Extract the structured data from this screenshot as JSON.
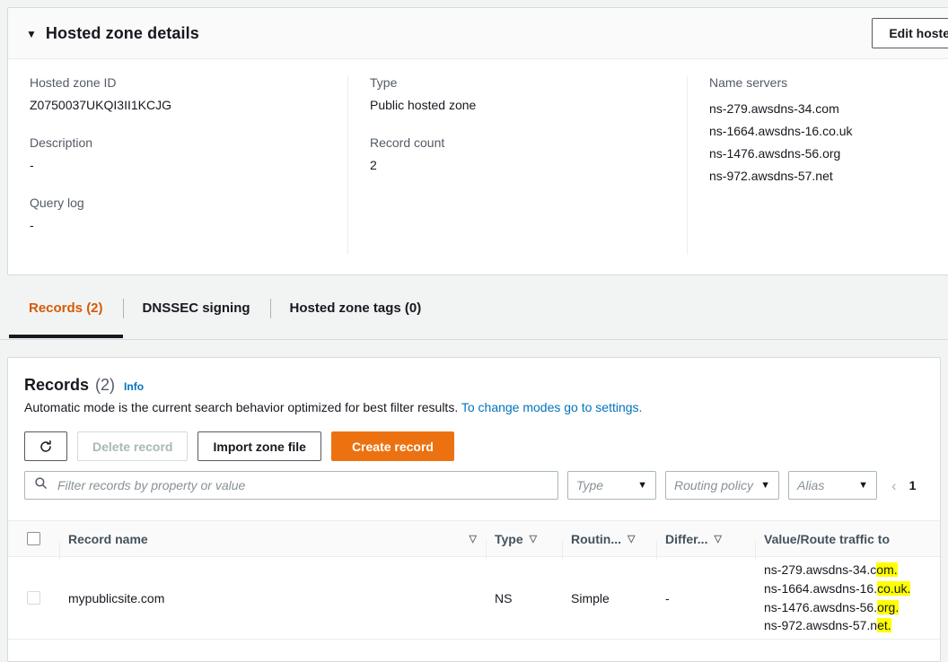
{
  "details": {
    "caret": "▼",
    "title": "Hosted zone details",
    "edit_button": "Edit hoste",
    "fields": {
      "hosted_zone_id_label": "Hosted zone ID",
      "hosted_zone_id_value": "Z0750037UKQI3II1KCJG",
      "description_label": "Description",
      "description_value": "-",
      "query_log_label": "Query log",
      "query_log_value": "-",
      "type_label": "Type",
      "type_value": "Public hosted zone",
      "record_count_label": "Record count",
      "record_count_value": "2",
      "name_servers_label": "Name servers"
    },
    "name_servers": [
      "ns-279.awsdns-34.com",
      "ns-1664.awsdns-16.co.uk",
      "ns-1476.awsdns-56.org",
      "ns-972.awsdns-57.net"
    ]
  },
  "tabs": [
    {
      "label": "Records (2)",
      "active": true
    },
    {
      "label": "DNSSEC signing",
      "active": false
    },
    {
      "label": "Hosted zone tags (0)",
      "active": false
    }
  ],
  "records_panel": {
    "title": "Records",
    "count": "(2)",
    "info": "Info",
    "subtitle_text": "Automatic mode is the current search behavior optimized for best filter results.",
    "subtitle_link": "To change modes go to settings.",
    "buttons": {
      "refresh": "refresh-icon",
      "delete": "Delete record",
      "import": "Import zone file",
      "create": "Create record"
    },
    "search": {
      "placeholder": "Filter records by property or value",
      "value": "",
      "icon": "search-icon"
    },
    "selects": {
      "type": "Type",
      "routing_policy": "Routing policy",
      "alias": "Alias",
      "arrow": "▼"
    },
    "pagination": {
      "prev": "‹",
      "page": "1"
    }
  },
  "table": {
    "headers": {
      "record_name": "Record name",
      "type": "Type",
      "routing": "Routin...",
      "differ": "Differ...",
      "value": "Value/Route traffic to"
    },
    "sort_caret": "▽",
    "rows": [
      {
        "record_name": "mypublicsite.com",
        "type": "NS",
        "routing": "Simple",
        "differ": "-",
        "values": [
          {
            "plain": "ns-279.awsdns-34.c",
            "highlighted": "om."
          },
          {
            "plain": "ns-1664.awsdns-16.",
            "highlighted": "co.uk."
          },
          {
            "plain": "ns-1476.awsdns-56.",
            "highlighted": "org."
          },
          {
            "plain": "ns-972.awsdns-57.n",
            "highlighted": "et."
          }
        ]
      }
    ]
  },
  "colors": {
    "accent_orange": "#ec7211",
    "tab_active": "#d45b07",
    "link_blue": "#0073bb",
    "highlight_yellow": "#ffff00",
    "page_bg": "#f2f3f3"
  }
}
